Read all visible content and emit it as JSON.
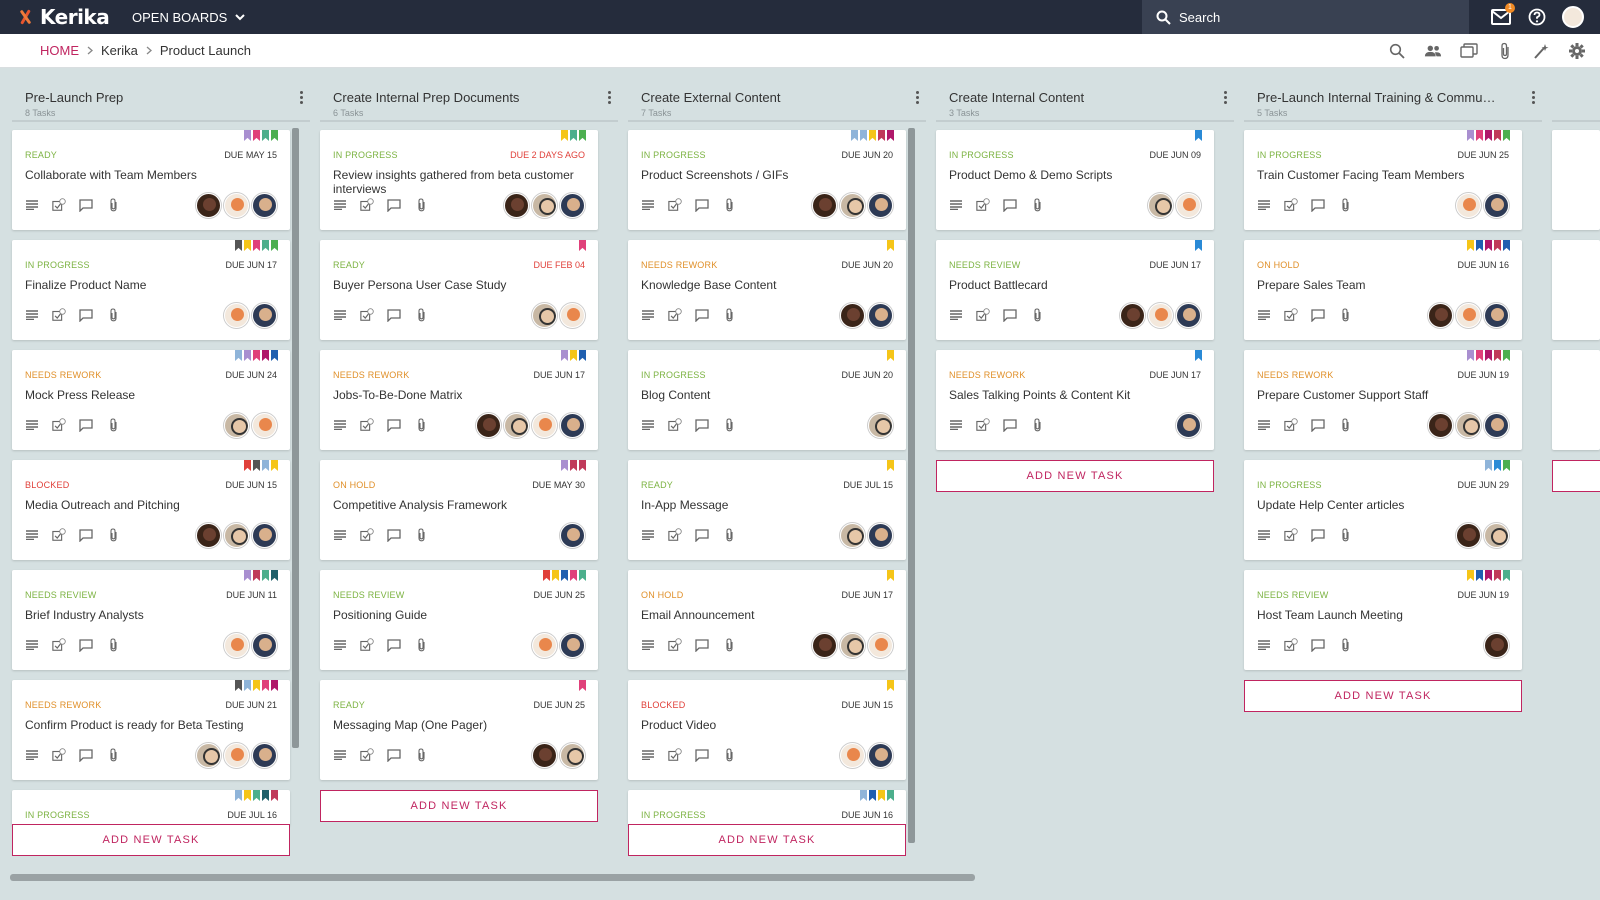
{
  "app": {
    "name": "Kerika",
    "open_boards": "OPEN BOARDS"
  },
  "search": {
    "placeholder": "Search"
  },
  "notifications": {
    "count": "1"
  },
  "breadcrumb": {
    "home": "HOME",
    "account": "Kerika",
    "board": "Product Launch"
  },
  "colors": {
    "accent": "#c02560",
    "topbar": "#252c3c",
    "board_bg": "#d5e0e1",
    "status": {
      "READY": "#7cb342",
      "IN PROGRESS": "#7cb342",
      "NEEDS REWORK": "#e0902a",
      "NEEDS REVIEW": "#7cb342",
      "BLOCKED": "#e0403a",
      "ON HOLD": "#e0902a"
    }
  },
  "add_task_label": "ADD NEW TASK",
  "columns": [
    {
      "title": "Pre-Launch Prep",
      "count": "8 Tasks",
      "cards": [
        {
          "status": "READY",
          "due": "DUE MAY 15",
          "title": "Collaborate with Team Members",
          "flags": [
            "#a98fd0",
            "#e0407a",
            "#4caf8c",
            "#4caf50"
          ],
          "avatars": [
            "dark",
            "orange",
            "navy"
          ]
        },
        {
          "status": "IN PROGRESS",
          "due": "DUE JUN 17",
          "title": "Finalize Product Name",
          "flags": [
            "#555",
            "#f5c518",
            "#e0407a",
            "#4caf8c",
            "#4caf50"
          ],
          "avatars": [
            "orange",
            "navy"
          ]
        },
        {
          "status": "NEEDS REWORK",
          "due": "DUE JUN 24",
          "title": "Mock Press Release",
          "flags": [
            "#8fb4d9",
            "#a98fd0",
            "#e0407a",
            "#b0186a",
            "#1f5fb0"
          ],
          "avatars": [
            "mid",
            "orange"
          ]
        },
        {
          "status": "BLOCKED",
          "due": "DUE JUN 15",
          "title": "Media Outreach and Pitching",
          "flags": [
            "#e0403a",
            "#555",
            "#8fb4d9",
            "#f5c518"
          ],
          "avatars": [
            "dark",
            "mid",
            "navy"
          ]
        },
        {
          "status": "NEEDS REVIEW",
          "due": "DUE JUN 11",
          "title": "Brief Industry Analysts",
          "flags": [
            "#a98fd0",
            "#c0395a",
            "#4caf8c",
            "#1f5f6a"
          ],
          "avatars": [
            "orange",
            "navy"
          ]
        },
        {
          "status": "NEEDS REWORK",
          "due": "DUE JUN 21",
          "title": "Confirm Product is ready for Beta Testing",
          "flags": [
            "#555",
            "#8fb4d9",
            "#f5c518",
            "#e0407a",
            "#b0186a"
          ],
          "avatars": [
            "mid",
            "orange",
            "navy"
          ]
        },
        {
          "status": "IN PROGRESS",
          "due": "DUE JUL 16",
          "title": "",
          "flags": [
            "#8fb4d9",
            "#f5c518",
            "#4caf8c",
            "#1f5f6a",
            "#c0395a"
          ],
          "avatars": []
        }
      ]
    },
    {
      "title": "Create Internal Prep Documents",
      "count": "6 Tasks",
      "cards": [
        {
          "status": "IN PROGRESS",
          "due": "DUE 2 DAYS AGO",
          "overdue": true,
          "title": "Review insights gathered from beta customer interviews",
          "flags": [
            "#f5c518",
            "#4caf8c",
            "#4caf50"
          ],
          "avatars": [
            "dark",
            "mid",
            "navy"
          ]
        },
        {
          "status": "READY",
          "due": "DUE FEB 04",
          "overdue": true,
          "title": "Buyer Persona User Case Study",
          "flags": [
            "#e0407a"
          ],
          "avatars": [
            "mid",
            "orange"
          ]
        },
        {
          "status": "NEEDS REWORK",
          "due": "DUE JUN 17",
          "title": "Jobs-To-Be-Done Matrix",
          "flags": [
            "#a98fd0",
            "#f5c518",
            "#1f5fb0"
          ],
          "avatars": [
            "dark",
            "mid",
            "orange",
            "navy"
          ]
        },
        {
          "status": "ON HOLD",
          "due": "DUE MAY 30",
          "title": "Competitive Analysis Framework",
          "flags": [
            "#a98fd0",
            "#c0395a",
            "#c0395a"
          ],
          "avatars": [
            "navy"
          ]
        },
        {
          "status": "NEEDS REVIEW",
          "due": "DUE JUN 25",
          "title": "Positioning Guide",
          "flags": [
            "#e0403a",
            "#f5c518",
            "#1f5fb0",
            "#e0407a",
            "#4caf8c"
          ],
          "avatars": [
            "orange",
            "navy"
          ]
        },
        {
          "status": "READY",
          "due": "DUE JUN 25",
          "title": "Messaging Map (One Pager)",
          "flags": [
            "#e0407a"
          ],
          "avatars": [
            "dark",
            "mid"
          ]
        }
      ]
    },
    {
      "title": "Create External Content",
      "count": "7 Tasks",
      "cards": [
        {
          "status": "IN PROGRESS",
          "due": "DUE JUN 20",
          "title": "Product Screenshots / GIFs",
          "flags": [
            "#8fb4d9",
            "#8fb4d9",
            "#f5c518",
            "#c0395a",
            "#b0186a"
          ],
          "avatars": [
            "dark",
            "mid",
            "navy"
          ]
        },
        {
          "status": "NEEDS REWORK",
          "due": "DUE JUN 20",
          "title": "Knowledge Base Content",
          "flags": [
            "#f5c518"
          ],
          "avatars": [
            "dark",
            "navy"
          ]
        },
        {
          "status": "IN PROGRESS",
          "due": "DUE JUN 20",
          "title": "Blog Content",
          "flags": [
            "#f5c518"
          ],
          "avatars": [
            "mid"
          ]
        },
        {
          "status": "READY",
          "due": "DUE JUL 15",
          "title": "In-App Message",
          "flags": [
            "#f5c518"
          ],
          "avatars": [
            "mid",
            "navy"
          ]
        },
        {
          "status": "ON HOLD",
          "due": "DUE JUN 17",
          "title": "Email Announcement",
          "flags": [
            "#f5c518"
          ],
          "avatars": [
            "dark",
            "mid",
            "orange"
          ]
        },
        {
          "status": "BLOCKED",
          "due": "DUE JUN 15",
          "title": "Product Video",
          "flags": [
            "#f5c518"
          ],
          "avatars": [
            "orange",
            "navy"
          ]
        },
        {
          "status": "IN PROGRESS",
          "due": "DUE JUN 16",
          "title": "",
          "flags": [
            "#8fb4d9",
            "#1f5fb0",
            "#f5c518",
            "#4caf8c"
          ],
          "avatars": []
        }
      ]
    },
    {
      "title": "Create Internal Content",
      "count": "3 Tasks",
      "cards": [
        {
          "status": "IN PROGRESS",
          "due": "DUE JUN 09",
          "title": "Product Demo & Demo Scripts",
          "flags": [
            "#2a8ad6"
          ],
          "avatars": [
            "mid",
            "orange"
          ]
        },
        {
          "status": "NEEDS REVIEW",
          "due": "DUE JUN 17",
          "title": "Product Battlecard",
          "flags": [
            "#2a8ad6"
          ],
          "avatars": [
            "dark",
            "orange",
            "navy"
          ]
        },
        {
          "status": "NEEDS REWORK",
          "due": "DUE JUN 17",
          "title": "Sales Talking Points & Content Kit",
          "flags": [
            "#2a8ad6"
          ],
          "avatars": [
            "navy"
          ]
        }
      ]
    },
    {
      "title": "Pre-Launch Internal Training & Communi...",
      "count": "5 Tasks",
      "cards": [
        {
          "status": "IN PROGRESS",
          "due": "DUE JUN 25",
          "title": "Train Customer Facing Team Members",
          "flags": [
            "#a98fd0",
            "#e0407a",
            "#b0186a",
            "#c0395a",
            "#4caf50"
          ],
          "avatars": [
            "orange",
            "navy"
          ]
        },
        {
          "status": "ON HOLD",
          "due": "DUE JUN 16",
          "title": "Prepare Sales Team",
          "flags": [
            "#f5c518",
            "#1f5fb0",
            "#b0186a",
            "#c0395a",
            "#1f5fb0"
          ],
          "avatars": [
            "dark",
            "orange",
            "navy"
          ]
        },
        {
          "status": "NEEDS REWORK",
          "due": "DUE JUN 19",
          "title": "Prepare Customer Support Staff",
          "flags": [
            "#a98fd0",
            "#e0407a",
            "#b0186a",
            "#c0395a",
            "#4caf50"
          ],
          "avatars": [
            "dark",
            "mid",
            "navy"
          ]
        },
        {
          "status": "IN PROGRESS",
          "due": "DUE JUN 29",
          "title": "Update Help Center articles",
          "flags": [
            "#8fb4d9",
            "#2a8ad6",
            "#4caf50"
          ],
          "avatars": [
            "dark",
            "mid"
          ]
        },
        {
          "status": "NEEDS REVIEW",
          "due": "DUE JUN 19",
          "title": "Host Team Launch Meeting",
          "flags": [
            "#f5c518",
            "#1f5fb0",
            "#b0186a",
            "#c0395a",
            "#4caf8c"
          ],
          "avatars": [
            "dark"
          ]
        }
      ]
    }
  ]
}
